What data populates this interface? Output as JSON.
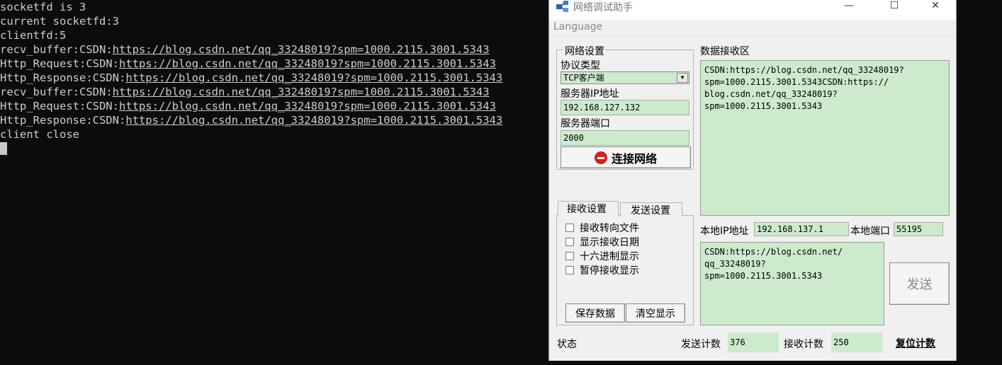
{
  "terminal": {
    "lines": [
      {
        "prefix": "socketfd is 3",
        "link": ""
      },
      {
        "prefix": "current socketfd:3",
        "link": ""
      },
      {
        "prefix": "clientfd:5",
        "link": ""
      },
      {
        "prefix": "recv_buffer:CSDN:",
        "link": "https://blog.csdn.net/qq_33248019?spm=1000.2115.3001.5343"
      },
      {
        "prefix": "Http_Request:CSDN:",
        "link": "https://blog.csdn.net/qq_33248019?spm=1000.2115.3001.5343"
      },
      {
        "prefix": "Http_Response:CSDN:",
        "link": "https://blog.csdn.net/qq_33248019?spm=1000.2115.3001.5343"
      },
      {
        "prefix": "recv_buffer:CSDN:",
        "link": "https://blog.csdn.net/qq_33248019?spm=1000.2115.3001.5343"
      },
      {
        "prefix": "Http_Request:CSDN:",
        "link": "https://blog.csdn.net/qq_33248019?spm=1000.2115.3001.5343"
      },
      {
        "prefix": "Http_Response:CSDN:",
        "link": "https://blog.csdn.net/qq_33248019?spm=1000.2115.3001.5343"
      },
      {
        "prefix": "client close",
        "link": ""
      }
    ]
  },
  "app": {
    "title": "网络调试助手",
    "menu": {
      "language": "Language"
    },
    "window_controls": {
      "minimize": "—",
      "maximize": "☐",
      "close": "✕"
    },
    "network_group": {
      "title": "网络设置",
      "protocol_label": "协议类型",
      "protocol_value": "TCP客户端",
      "server_ip_label": "服务器IP地址",
      "server_ip_value": "192.168.127.132",
      "server_port_label": "服务器端口",
      "server_port_value": "2000",
      "connect_label": "连接网络"
    },
    "receive_area": {
      "label": "数据接收区",
      "content": "CSDN:https://blog.csdn.net/qq_33248019?\nspm=1000.2115.3001.5343CSDN:https://\nblog.csdn.net/qq_33248019?\nspm=1000.2115.3001.5343"
    },
    "local": {
      "ip_label": "本地IP地址",
      "ip_value": "192.168.137.1",
      "port_label": "本地端口",
      "port_value": "55195"
    },
    "send_area": {
      "content": "CSDN:https://blog.csdn.net/\nqq_33248019?\nspm=1000.2115.3001.5343",
      "send_label": "发送"
    },
    "tabs": [
      {
        "label": "接收设置"
      },
      {
        "label": "发送设置"
      }
    ],
    "recv_options": [
      {
        "label": "接收转向文件",
        "checked": false
      },
      {
        "label": "显示接收日期",
        "checked": false
      },
      {
        "label": "十六进制显示",
        "checked": false
      },
      {
        "label": "暂停接收显示",
        "checked": false
      }
    ],
    "buttons": {
      "save_data": "保存数据",
      "clear_display": "清空显示"
    },
    "status": {
      "label": "状态",
      "send_count_label": "发送计数",
      "send_count_value": "376",
      "recv_count_label": "接收计数",
      "recv_count_value": "250",
      "reset_label": "复位计数"
    }
  }
}
